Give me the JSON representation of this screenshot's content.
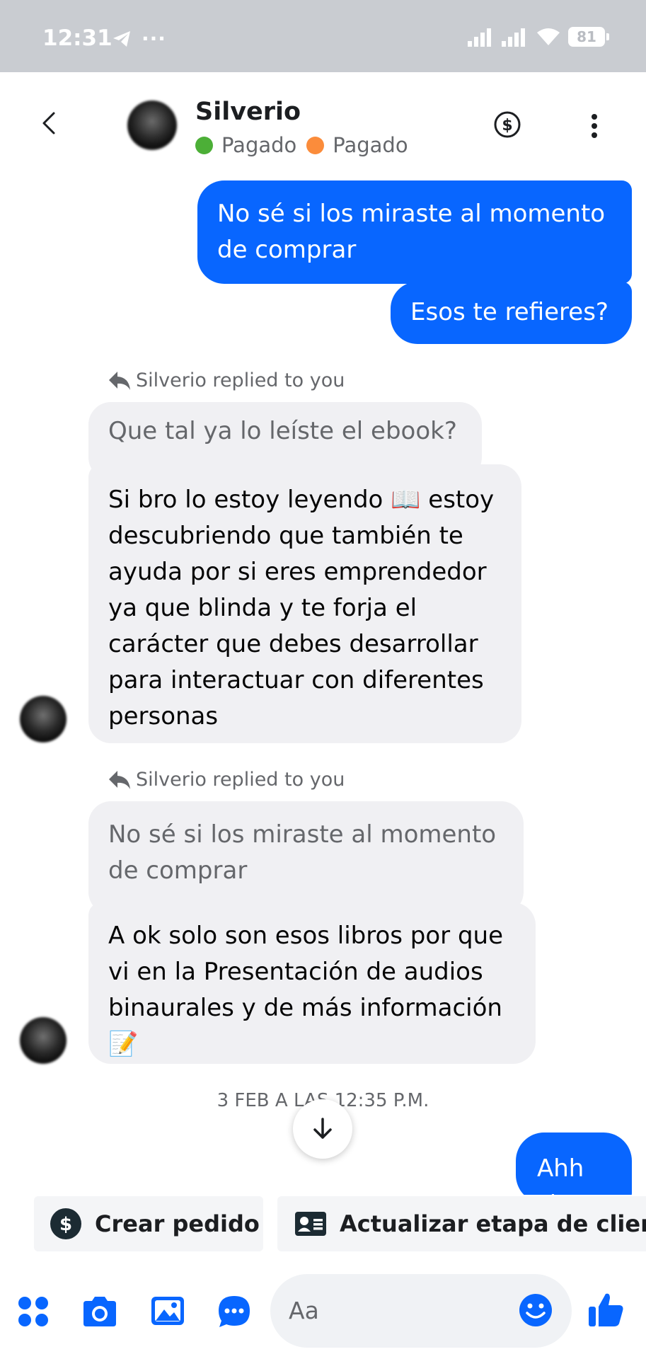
{
  "status_bar": {
    "time": "12:31",
    "dots": "···",
    "battery": "81"
  },
  "header": {
    "name": "Silverio",
    "labels": [
      {
        "text": "Pagado",
        "color": "#4caf37"
      },
      {
        "text": "Pagado",
        "color": "#fb8c3b"
      }
    ]
  },
  "messages": {
    "out1": "No sé si los miraste al momento de comprar",
    "out2": "Esos te refieres?",
    "reply1": {
      "indicator": "Silverio replied to you",
      "quote": "Que tal ya lo leíste el ebook?",
      "text": "Si bro lo estoy leyendo 📖 estoy descubriendo que también te ayuda por si eres emprendedor ya que  blinda y te forja el carácter que debes desarrollar para interactuar con diferentes personas"
    },
    "reply2": {
      "indicator": "Silverio replied to you",
      "quote": "No sé si los miraste al momento de comprar",
      "text": "A ok solo son esos libros por que vi en la Presentación de audios binaurales y de más información 📝"
    },
    "timestamp": "3 FEB A LAS 12:35 P.M.",
    "out3": "Ahh si"
  },
  "quick_actions": {
    "create_order": "Crear pedido",
    "update_stage": "Actualizar etapa de cliente"
  },
  "composer": {
    "placeholder": "Aa"
  },
  "colors": {
    "accent": "#0866ff",
    "incoming_bubble": "#f0f0f3",
    "status_bar": "#c9ccd1"
  },
  "icons": [
    "telegram-icon",
    "signal-icon",
    "wifi-icon",
    "battery-icon",
    "back-icon",
    "dollar-icon",
    "more-icon",
    "reply-icon",
    "arrow-down-icon",
    "dollar-circle-icon",
    "contact-card-icon",
    "apps-icon",
    "camera-icon",
    "gallery-icon",
    "chat-bubble-icon",
    "emoji-icon",
    "thumbs-up-icon"
  ]
}
